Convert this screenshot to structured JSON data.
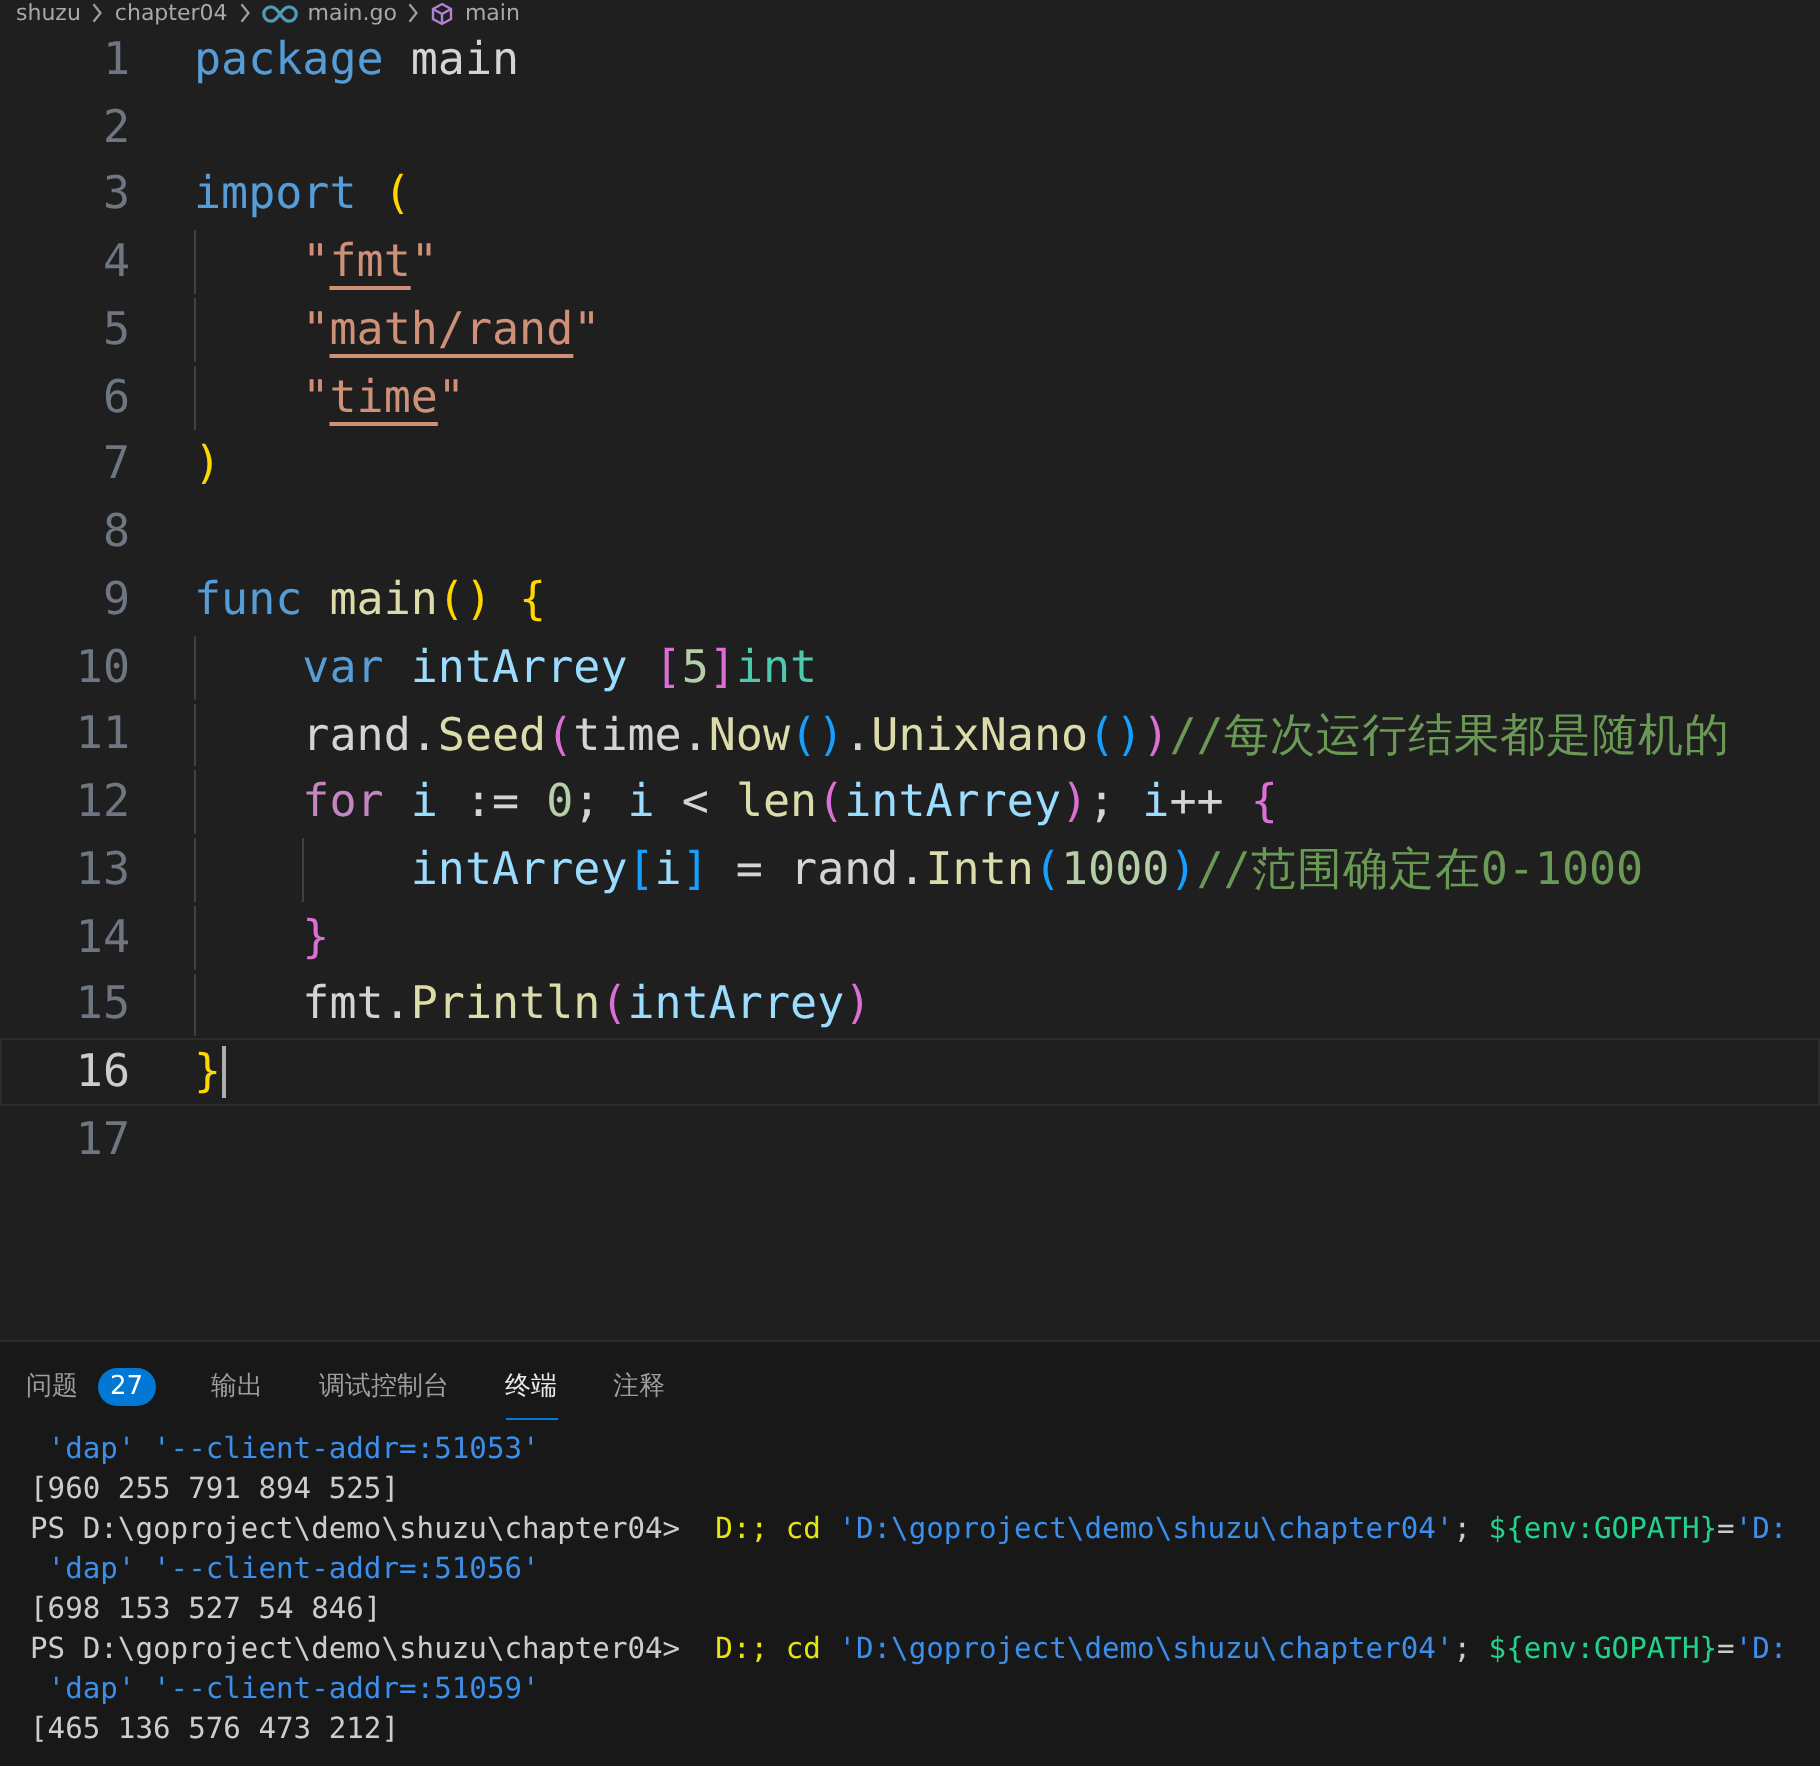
{
  "breadcrumb": [
    {
      "kind": "folder",
      "label": "shuzu"
    },
    {
      "kind": "folder",
      "label": "chapter04"
    },
    {
      "kind": "gofile",
      "label": "main.go"
    },
    {
      "kind": "symbol",
      "label": "main"
    }
  ],
  "editor": {
    "lines": [
      {
        "number": "1",
        "active": false,
        "tokens": [
          {
            "kind": "keyword",
            "text": "package"
          },
          {
            "kind": "plain",
            "text": " main"
          }
        ]
      },
      {
        "number": "2",
        "active": false
      },
      {
        "number": "3",
        "active": false,
        "tokens": [
          {
            "kind": "keyword",
            "text": "import"
          },
          {
            "kind": "bracket1",
            "text": " ("
          }
        ]
      },
      {
        "number": "4",
        "active": false,
        "tokens": [
          {
            "kind": "string",
            "text": "    \""
          },
          {
            "kind": "link",
            "text": "fmt"
          },
          {
            "kind": "string",
            "text": "\""
          }
        ]
      },
      {
        "number": "5",
        "active": false,
        "tokens": [
          {
            "kind": "string",
            "text": "    \""
          },
          {
            "kind": "link",
            "text": "math/rand"
          },
          {
            "kind": "string",
            "text": "\""
          }
        ]
      },
      {
        "number": "6",
        "active": false,
        "tokens": [
          {
            "kind": "string",
            "text": "    \""
          },
          {
            "kind": "link",
            "text": "time"
          },
          {
            "kind": "string",
            "text": "\""
          }
        ]
      },
      {
        "number": "7",
        "active": false,
        "tokens": [
          {
            "kind": "bracket1",
            "text": ")"
          }
        ]
      },
      {
        "number": "8",
        "active": false
      },
      {
        "number": "9",
        "active": false,
        "tokens": [
          {
            "kind": "keyword",
            "text": "func"
          },
          {
            "kind": "function",
            "text": " main"
          },
          {
            "kind": "bracket1",
            "text": "()"
          },
          {
            "kind": "bracket1",
            "text": " {"
          }
        ]
      },
      {
        "number": "10",
        "active": false,
        "tokens": [
          {
            "kind": "keyword",
            "text": "    var"
          },
          {
            "kind": "variable",
            "text": " intArrey"
          },
          {
            "kind": "bracket2",
            "text": " ["
          },
          {
            "kind": "number",
            "text": "5"
          },
          {
            "kind": "bracket2",
            "text": "]"
          },
          {
            "kind": "type",
            "text": "int"
          }
        ]
      },
      {
        "number": "11",
        "active": false,
        "tokens": [
          {
            "kind": "plain",
            "text": "    rand."
          },
          {
            "kind": "function",
            "text": "Seed"
          },
          {
            "kind": "bracket2",
            "text": "("
          },
          {
            "kind": "plain",
            "text": "time."
          },
          {
            "kind": "function",
            "text": "Now"
          },
          {
            "kind": "bracket3",
            "text": "()"
          },
          {
            "kind": "plain",
            "text": "."
          },
          {
            "kind": "function",
            "text": "UnixNano"
          },
          {
            "kind": "bracket3",
            "text": "()"
          },
          {
            "kind": "bracket2",
            "text": ")"
          },
          {
            "kind": "comment",
            "text": "//每次运行结果都是随机的"
          }
        ]
      },
      {
        "number": "12",
        "active": false,
        "tokens": [
          {
            "kind": "control",
            "text": "    for"
          },
          {
            "kind": "variable",
            "text": " i"
          },
          {
            "kind": "plain",
            "text": " := "
          },
          {
            "kind": "number",
            "text": "0"
          },
          {
            "kind": "plain",
            "text": "; "
          },
          {
            "kind": "variable",
            "text": "i"
          },
          {
            "kind": "plain",
            "text": " < "
          },
          {
            "kind": "function",
            "text": "len"
          },
          {
            "kind": "bracket2",
            "text": "("
          },
          {
            "kind": "variable",
            "text": "intArrey"
          },
          {
            "kind": "bracket2",
            "text": ")"
          },
          {
            "kind": "plain",
            "text": "; "
          },
          {
            "kind": "variable",
            "text": "i"
          },
          {
            "kind": "plain",
            "text": "++"
          },
          {
            "kind": "bracket2",
            "text": " {"
          }
        ]
      },
      {
        "number": "13",
        "active": false,
        "tokens": [
          {
            "kind": "variable",
            "text": "        intArrey"
          },
          {
            "kind": "bracket3",
            "text": "["
          },
          {
            "kind": "variable",
            "text": "i"
          },
          {
            "kind": "bracket3",
            "text": "]"
          },
          {
            "kind": "plain",
            "text": " = rand."
          },
          {
            "kind": "function",
            "text": "Intn"
          },
          {
            "kind": "bracket3",
            "text": "("
          },
          {
            "kind": "number",
            "text": "1000"
          },
          {
            "kind": "bracket3",
            "text": ")"
          },
          {
            "kind": "comment",
            "text": "//范围确定在0-1000"
          }
        ]
      },
      {
        "number": "14",
        "active": false,
        "tokens": [
          {
            "kind": "bracket2",
            "text": "    }"
          }
        ]
      },
      {
        "number": "15",
        "active": false,
        "tokens": [
          {
            "kind": "plain",
            "text": "    fmt."
          },
          {
            "kind": "function",
            "text": "Println"
          },
          {
            "kind": "bracket2",
            "text": "("
          },
          {
            "kind": "variable",
            "text": "intArrey"
          },
          {
            "kind": "bracket2",
            "text": ")"
          }
        ]
      },
      {
        "number": "16",
        "active": true,
        "tokens": [
          {
            "kind": "bracket1",
            "text": "}"
          }
        ]
      },
      {
        "number": "17",
        "active": false
      }
    ]
  },
  "panel": {
    "tabs": [
      {
        "label": "问题",
        "badge": "27",
        "selected": false
      },
      {
        "label": "输出",
        "selected": false
      },
      {
        "label": "调试控制台",
        "selected": false
      },
      {
        "label": "终端",
        "selected": true
      },
      {
        "label": "注释",
        "selected": false
      }
    ],
    "terminal": [
      [
        {
          "kind": "path",
          "text": " 'dap' '--client-addr=:51053'"
        }
      ],
      [
        {
          "kind": "plain",
          "text": "[960 255 791 894 525]"
        }
      ],
      [
        {
          "kind": "plain",
          "text": "PS D:\\goproject\\demo\\shuzu\\chapter04>  "
        },
        {
          "kind": "command",
          "text": "D:; cd "
        },
        {
          "kind": "path",
          "text": "'D:\\goproject\\demo\\shuzu\\chapter04'"
        },
        {
          "kind": "plain",
          "text": "; "
        },
        {
          "kind": "variable",
          "text": "${env:GOPATH}"
        },
        {
          "kind": "plain",
          "text": "="
        },
        {
          "kind": "path",
          "text": "'D:"
        }
      ],
      [
        {
          "kind": "path",
          "text": " 'dap' '--client-addr=:51056'"
        }
      ],
      [
        {
          "kind": "plain",
          "text": "[698 153 527 54 846]"
        }
      ],
      [
        {
          "kind": "plain",
          "text": "PS D:\\goproject\\demo\\shuzu\\chapter04>  "
        },
        {
          "kind": "command",
          "text": "D:; cd "
        },
        {
          "kind": "path",
          "text": "'D:\\goproject\\demo\\shuzu\\chapter04'"
        },
        {
          "kind": "plain",
          "text": "; "
        },
        {
          "kind": "variable",
          "text": "${env:GOPATH}"
        },
        {
          "kind": "plain",
          "text": "="
        },
        {
          "kind": "path",
          "text": "'D:"
        }
      ],
      [
        {
          "kind": "path",
          "text": " 'dap' '--client-addr=:51059'"
        }
      ],
      [
        {
          "kind": "plain",
          "text": "[465 136 576 473 212]"
        }
      ]
    ]
  }
}
